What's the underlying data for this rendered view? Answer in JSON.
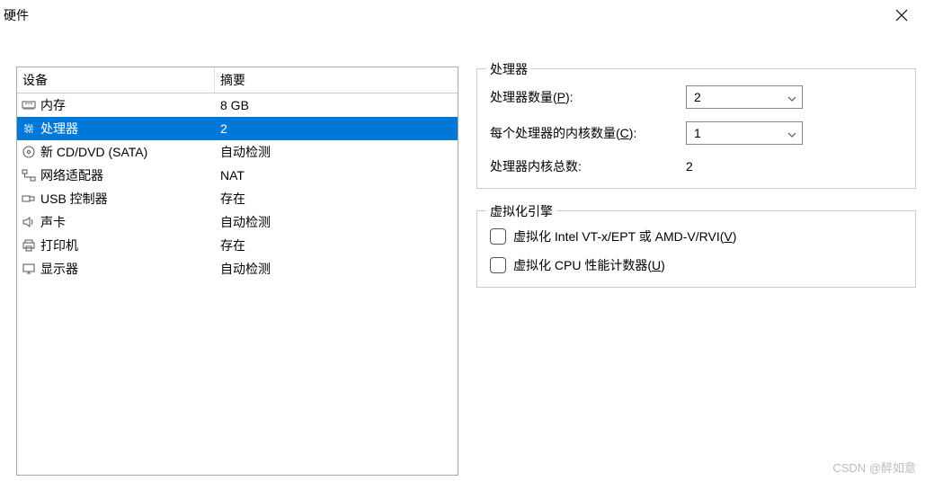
{
  "window": {
    "title": "硬件"
  },
  "hardware": {
    "headers": {
      "device": "设备",
      "summary": "摘要"
    },
    "rows": [
      {
        "name": "内存",
        "summary": "8 GB",
        "icon": "memory"
      },
      {
        "name": "处理器",
        "summary": "2",
        "icon": "cpu",
        "selected": true
      },
      {
        "name": "新 CD/DVD (SATA)",
        "summary": "自动检测",
        "icon": "disc"
      },
      {
        "name": "网络适配器",
        "summary": "NAT",
        "icon": "network"
      },
      {
        "name": "USB 控制器",
        "summary": "存在",
        "icon": "usb"
      },
      {
        "name": "声卡",
        "summary": "自动检测",
        "icon": "sound"
      },
      {
        "name": "打印机",
        "summary": "存在",
        "icon": "printer"
      },
      {
        "name": "显示器",
        "summary": "自动检测",
        "icon": "display"
      }
    ]
  },
  "processor": {
    "group_title": "处理器",
    "count_label_pre": "处理器数量(",
    "count_label_key": "P",
    "count_label_post": "):",
    "count_value": "2",
    "cores_label_pre": "每个处理器的内核数量(",
    "cores_label_key": "C",
    "cores_label_post": "):",
    "cores_value": "1",
    "total_label": "处理器内核总数:",
    "total_value": "2"
  },
  "virtualization": {
    "group_title": "虚拟化引擎",
    "opt1_pre": "虚拟化 Intel VT-x/EPT 或 AMD-V/RVI(",
    "opt1_key": "V",
    "opt1_post": ")",
    "opt2_pre": "虚拟化 CPU 性能计数器(",
    "opt2_key": "U",
    "opt2_post": ")"
  },
  "watermark": "CSDN @醉如意"
}
